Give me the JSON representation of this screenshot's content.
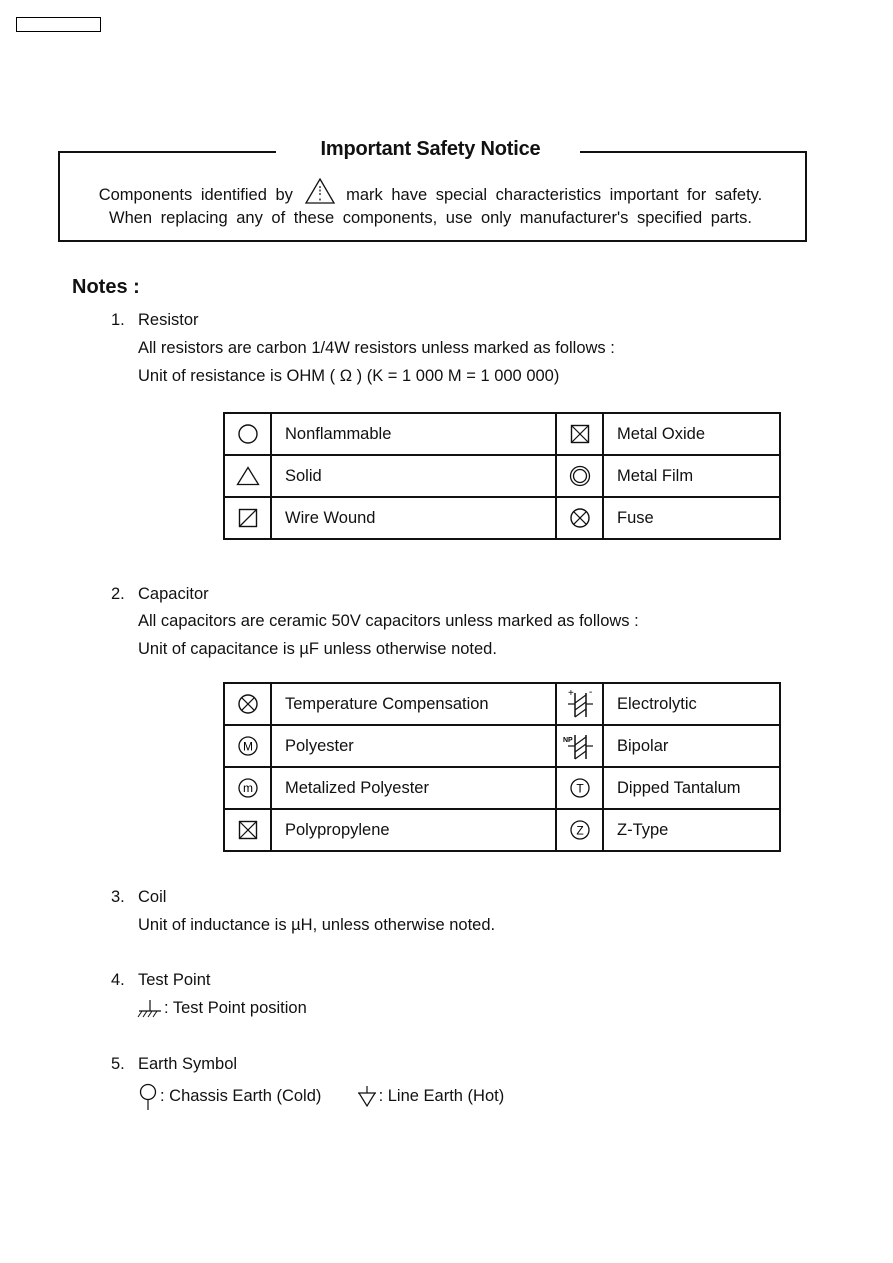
{
  "header_box": {
    "label": ""
  },
  "safety_notice": {
    "title": "Important Safety Notice",
    "line1_before": "Components identified by",
    "line1_after": "mark have special characteristics important for safety.",
    "line2": "When replacing any of these components, use only manufacturer's specified parts.",
    "icon": "warning-triangle-icon"
  },
  "notes": {
    "heading": "Notes :",
    "items": [
      {
        "number": "1.",
        "title": "Resistor",
        "lines": [
          "All resistors are carbon 1/4W resistors unless marked as follows :",
          "Unit of resistance is OHM ( Ω ) (K = 1 000 M = 1 000 000)"
        ],
        "table": [
          [
            {
              "icon": "circle-icon",
              "label": "Nonflammable"
            },
            {
              "icon": "boxed-x-icon",
              "label": "Metal Oxide"
            }
          ],
          [
            {
              "icon": "triangle-icon",
              "label": "Solid"
            },
            {
              "icon": "double-circle-icon",
              "label": "Metal Film"
            }
          ],
          [
            {
              "icon": "boxed-slash-icon",
              "label": "Wire Wound"
            },
            {
              "icon": "circled-x-icon",
              "label": "Fuse"
            }
          ]
        ]
      },
      {
        "number": "2.",
        "title": "Capacitor",
        "lines": [
          "All capacitors are ceramic 50V capacitors unless marked as follows :",
          "Unit of capacitance is  µF unless otherwise noted."
        ],
        "table": [
          [
            {
              "icon": "circled-x-icon",
              "label": "Temperature Compensation"
            },
            {
              "icon": "electrolytic-capacitor-icon",
              "label": "Electrolytic"
            }
          ],
          [
            {
              "icon": "circled-M-icon",
              "label": "Polyester",
              "glyph": "M"
            },
            {
              "icon": "bipolar-capacitor-icon",
              "label": "Bipolar",
              "glyph": "NP"
            }
          ],
          [
            {
              "icon": "circled-m-icon",
              "label": "Metalized Polyester",
              "glyph": "m"
            },
            {
              "icon": "circled-T-icon",
              "label": "Dipped Tantalum",
              "glyph": "T"
            }
          ],
          [
            {
              "icon": "boxed-x-icon",
              "label": "Polypropylene"
            },
            {
              "icon": "circled-Z-icon",
              "label": "Z-Type",
              "glyph": "Z"
            }
          ]
        ]
      },
      {
        "number": "3.",
        "title": "Coil",
        "lines": [
          "Unit of inductance is µH, unless otherwise noted."
        ]
      },
      {
        "number": "4.",
        "title": "Test Point",
        "lines": [
          ": Test Point position"
        ],
        "icon": "test-point-icon"
      },
      {
        "number": "5.",
        "title": "Earth Symbol",
        "chassis_label": ": Chassis Earth (Cold)",
        "chassis_icon": "chassis-earth-icon",
        "line_label": ": Line Earth (Hot)",
        "line_icon": "line-earth-icon"
      }
    ]
  }
}
